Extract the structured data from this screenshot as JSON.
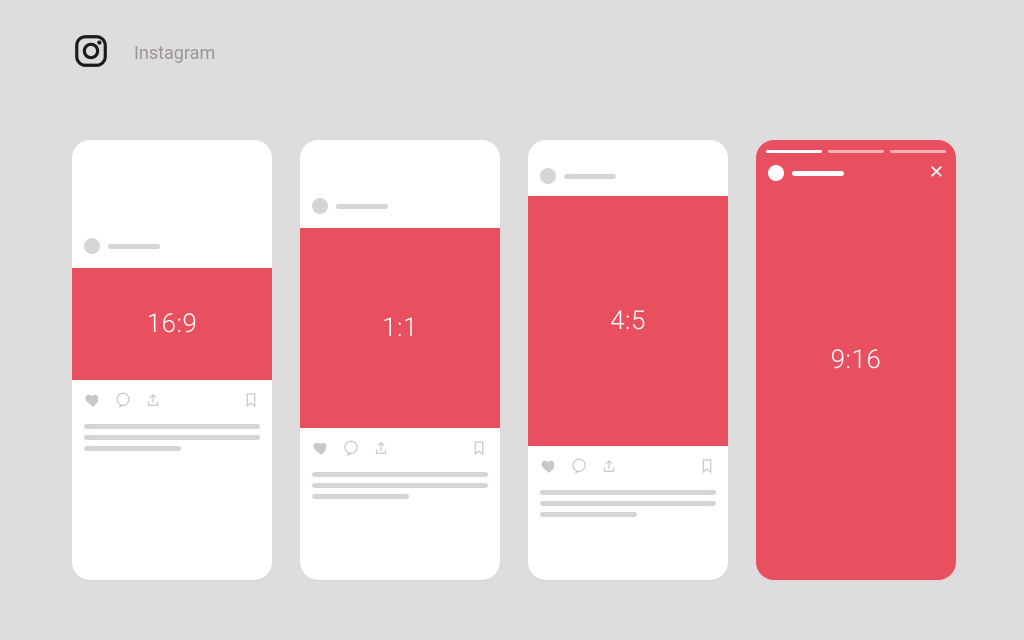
{
  "header": {
    "label": "Instagram"
  },
  "accent_color": "#e9505f",
  "cards": [
    {
      "kind": "feed",
      "ratio_label": "16:9"
    },
    {
      "kind": "feed",
      "ratio_label": "1:1"
    },
    {
      "kind": "feed",
      "ratio_label": "4:5"
    },
    {
      "kind": "story",
      "ratio_label": "9:16"
    }
  ],
  "icons": {
    "like": "heart-icon",
    "comment": "comment-icon",
    "share": "share-icon",
    "bookmark": "bookmark-icon",
    "close": "close-icon",
    "brand": "instagram-icon"
  }
}
